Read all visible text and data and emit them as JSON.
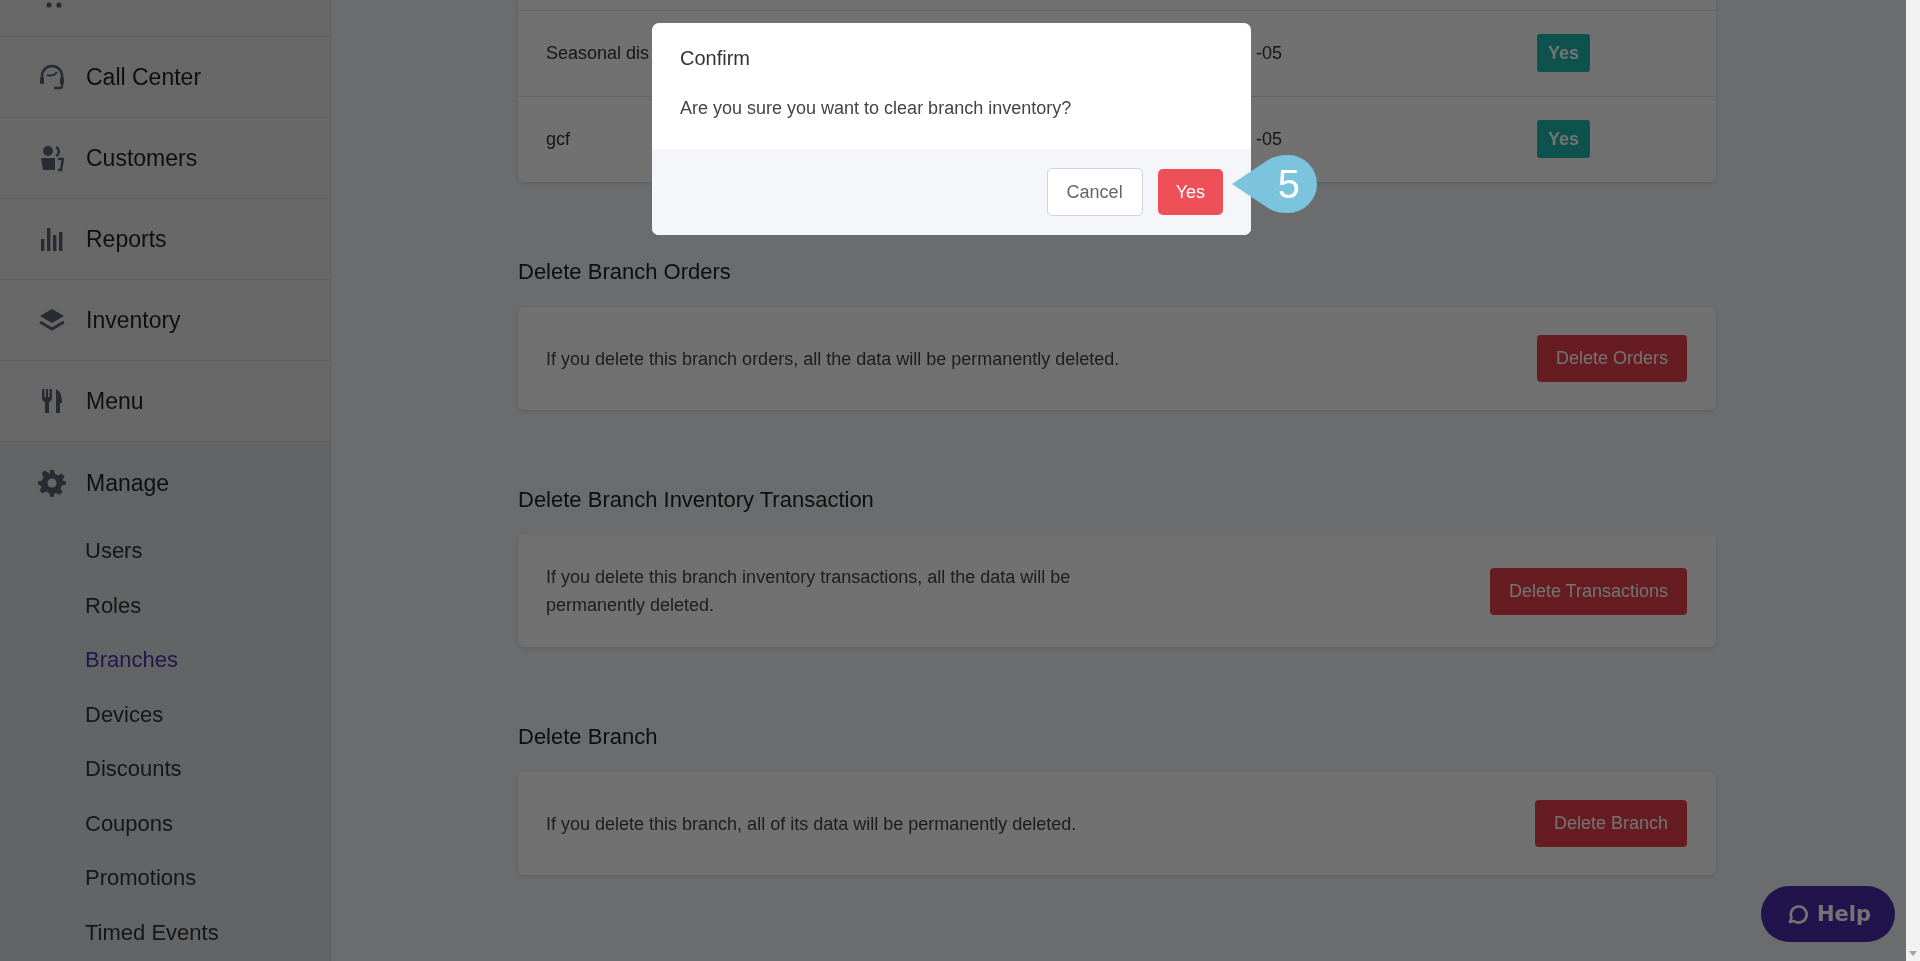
{
  "sidebar": {
    "items": [
      {
        "label": "Call Center"
      },
      {
        "label": "Customers"
      },
      {
        "label": "Reports"
      },
      {
        "label": "Inventory"
      },
      {
        "label": "Menu"
      }
    ],
    "manage": {
      "label": "Manage",
      "expanded": true,
      "children": [
        {
          "label": "Users",
          "selected": false
        },
        {
          "label": "Roles",
          "selected": false
        },
        {
          "label": "Branches",
          "selected": true
        },
        {
          "label": "Devices",
          "selected": false
        },
        {
          "label": "Discounts",
          "selected": false
        },
        {
          "label": "Coupons",
          "selected": false
        },
        {
          "label": "Promotions",
          "selected": false
        },
        {
          "label": "Timed Events",
          "selected": false
        }
      ]
    }
  },
  "table": {
    "rows": [
      {
        "column_1": "Seasonal dis",
        "column_2": "-05",
        "column_3": "Yes"
      },
      {
        "column_1": "gcf",
        "column_2": "-05",
        "column_3": "Yes"
      }
    ]
  },
  "sections": [
    {
      "title": "Delete Branch Orders",
      "text": "If you delete this branch orders, all the data will be permanently deleted.",
      "button": "Delete Orders"
    },
    {
      "title": "Delete Branch Inventory Transaction",
      "text": "If you delete this branch inventory transactions, all the data will be permanently deleted.",
      "button": "Delete Transactions"
    },
    {
      "title": "Delete Branch",
      "text": "If you delete this branch, all of its data will be permanently deleted.",
      "button": "Delete Branch"
    }
  ],
  "help_button": "Help",
  "dialog": {
    "title": "Confirm",
    "message": "Are you sure you want to clear branch inventory?",
    "cancel": "Cancel",
    "confirm": "Yes"
  },
  "step_badge": "5"
}
